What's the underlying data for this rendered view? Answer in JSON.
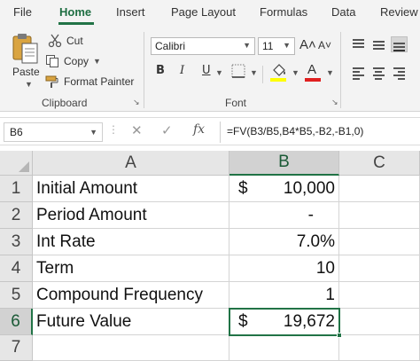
{
  "menu": {
    "tabs": [
      "File",
      "Home",
      "Insert",
      "Page Layout",
      "Formulas",
      "Data",
      "Review"
    ],
    "active_tab": "Home"
  },
  "ribbon": {
    "clipboard": {
      "label": "Clipboard",
      "paste": "Paste",
      "cut": "Cut",
      "copy": "Copy",
      "format_painter": "Format Painter"
    },
    "font": {
      "label": "Font",
      "font_name": "Calibri",
      "font_size": "11",
      "grow_glyph": "A˄",
      "shrink_glyph": "A˅",
      "bold": "B",
      "italic": "I",
      "underline": "U",
      "highlight_color": "#ffff00",
      "font_color": "#e02020"
    }
  },
  "formula_bar": {
    "name_box": "B6",
    "fx": "fx",
    "formula": "=FV(B3/B5,B4*B5,-B2,-B1,0)"
  },
  "sheet": {
    "columns": [
      "A",
      "B",
      "C"
    ],
    "selected_column": "B",
    "selected_row": "6",
    "active_cell": "B6",
    "rows": [
      {
        "num": "1",
        "a": "Initial Amount",
        "b_currency": "$",
        "b": "10,000"
      },
      {
        "num": "2",
        "a": "Period Amount",
        "b_currency": "",
        "b": "-"
      },
      {
        "num": "3",
        "a": "Int Rate",
        "b_currency": "",
        "b": "7.0%"
      },
      {
        "num": "4",
        "a": "Term",
        "b_currency": "",
        "b": "10"
      },
      {
        "num": "5",
        "a": "Compound Frequency",
        "b_currency": "",
        "b": "1"
      },
      {
        "num": "6",
        "a": "Future Value",
        "b_currency": "$",
        "b": "19,672"
      },
      {
        "num": "7",
        "a": "",
        "b_currency": "",
        "b": ""
      }
    ]
  },
  "colors": {
    "accent": "#217346",
    "ribbon_bg": "#f3f3f3",
    "header_bg": "#e6e6e6"
  }
}
